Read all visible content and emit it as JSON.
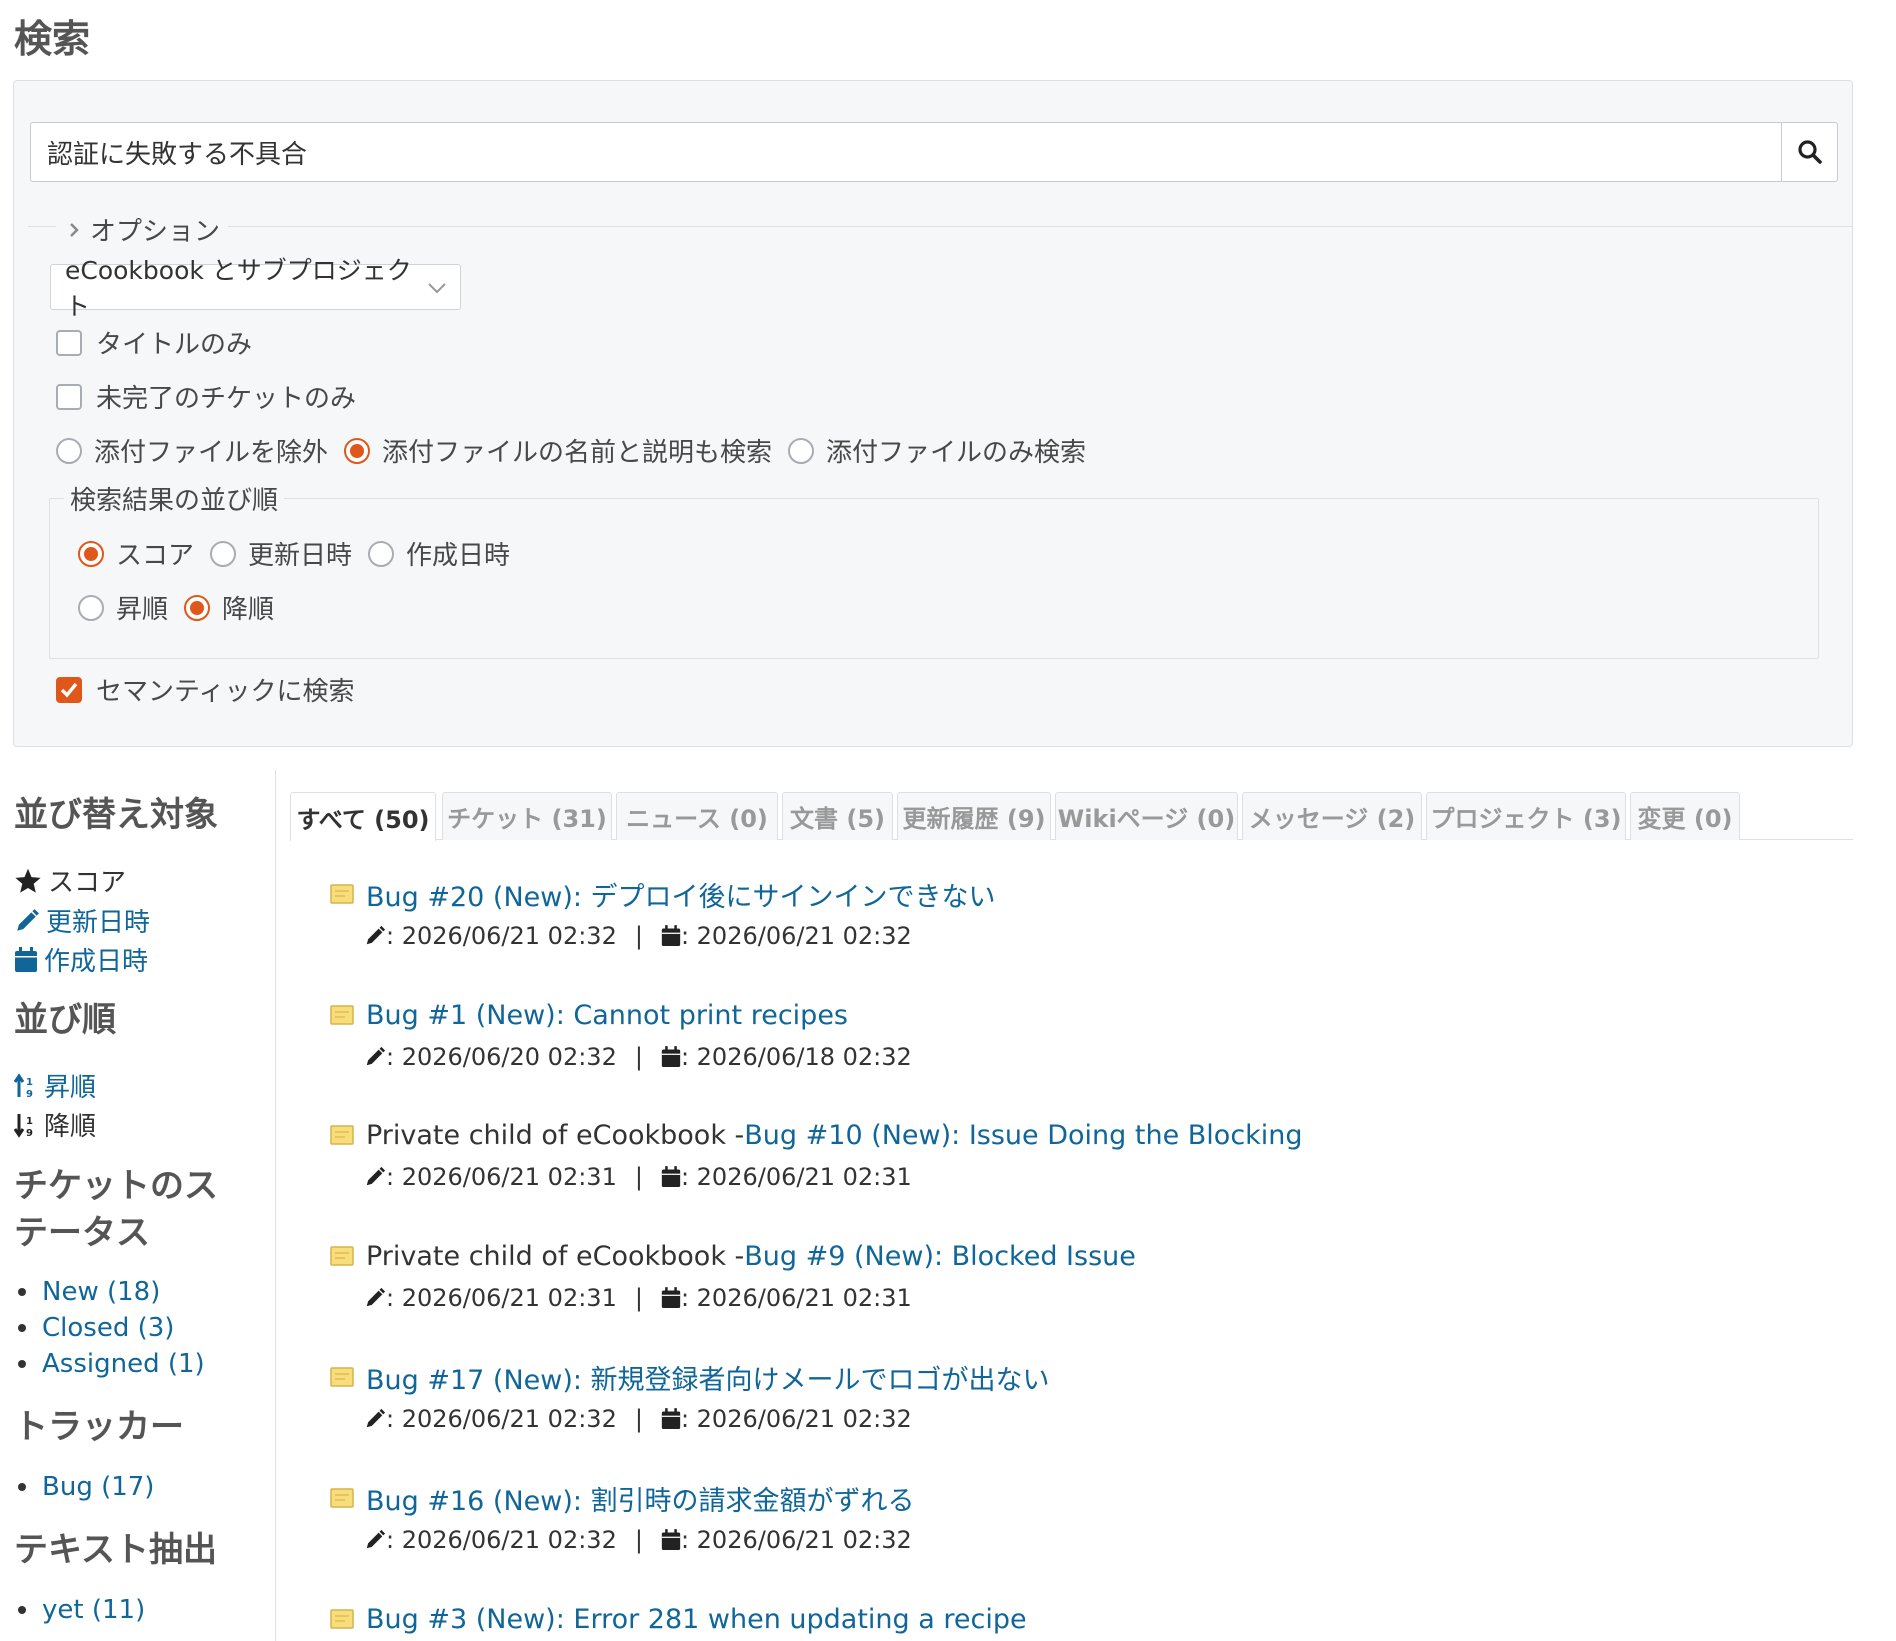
{
  "page": {
    "title": "検索"
  },
  "search": {
    "query": "認証に失敗する不具合",
    "options_label": "オプション",
    "scope": "eCookbook とサブプロジェクト",
    "titles_only": {
      "label": "タイトルのみ",
      "checked": false
    },
    "open_issues_only": {
      "label": "未完了のチケットのみ",
      "checked": false
    },
    "attachments": [
      {
        "label": "添付ファイルを除外",
        "checked": false
      },
      {
        "label": "添付ファイルの名前と説明も検索",
        "checked": true
      },
      {
        "label": "添付ファイルのみ検索",
        "checked": false
      }
    ],
    "sort": {
      "legend": "検索結果の並び順",
      "by": [
        {
          "label": "スコア",
          "checked": true
        },
        {
          "label": "更新日時",
          "checked": false
        },
        {
          "label": "作成日時",
          "checked": false
        }
      ],
      "order": [
        {
          "label": "昇順",
          "checked": false
        },
        {
          "label": "降順",
          "checked": true
        }
      ]
    },
    "semantic": {
      "label": "セマンティックに検索",
      "checked": true
    }
  },
  "sidebar": {
    "sort_target_heading": "並び替え対象",
    "sort_targets": [
      "スコア",
      "更新日時",
      "作成日時"
    ],
    "order_heading": "並び順",
    "orders": [
      "昇順",
      "降順"
    ],
    "status_heading_line1": "チケットのス",
    "status_heading_line2": "テータス",
    "statuses": [
      "New (18)",
      "Closed (3)",
      "Assigned (1)"
    ],
    "tracker_heading": "トラッカー",
    "trackers": [
      "Bug (17)"
    ],
    "text_heading": "テキスト抽出",
    "texts": [
      "yet (11)"
    ]
  },
  "tabs": [
    "すべて (50)",
    "チケット (31)",
    "ニュース (0)",
    "文書 (5)",
    "更新履歴 (9)",
    "Wikiページ (0)",
    "メッセージ (2)",
    "プロジェクト (3)",
    "変更 (0)"
  ],
  "results": [
    {
      "project": "",
      "title": "Bug #20 (New): デプロイ後にサインインできない",
      "updated": ": 2026/06/21 02:32",
      "created": ": 2026/06/21 02:32"
    },
    {
      "project": "",
      "title": "Bug #1 (New): Cannot print recipes",
      "updated": ": 2026/06/20 02:32",
      "created": ": 2026/06/18 02:32"
    },
    {
      "project": "Private child of eCookbook - ",
      "title": "Bug #10 (New): Issue Doing the Blocking",
      "updated": ": 2026/06/21 02:31",
      "created": ": 2026/06/21 02:31"
    },
    {
      "project": "Private child of eCookbook - ",
      "title": "Bug #9 (New): Blocked Issue",
      "updated": ": 2026/06/21 02:31",
      "created": ": 2026/06/21 02:31"
    },
    {
      "project": "",
      "title": "Bug #17 (New): 新規登録者向けメールでロゴが出ない",
      "updated": ": 2026/06/21 02:32",
      "created": ": 2026/06/21 02:32"
    },
    {
      "project": "",
      "title": "Bug #16 (New): 割引時の請求金額がずれる",
      "updated": ": 2026/06/21 02:32",
      "created": ": 2026/06/21 02:32"
    },
    {
      "project": "",
      "title": "Bug #3 (New): Error 281 when updating a recipe",
      "updated": "",
      "created": ""
    }
  ],
  "meta_separator": "|",
  "colors": {
    "accent": "#e0571a",
    "link": "#116699"
  }
}
